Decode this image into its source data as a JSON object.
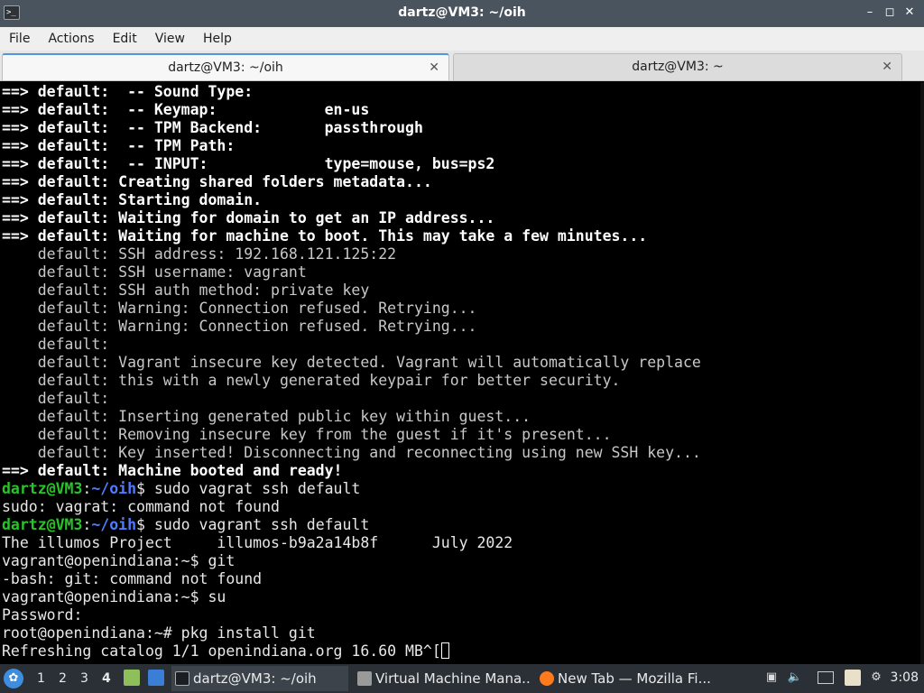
{
  "window": {
    "title": "dartz@VM3: ~/oih",
    "app_icon": "terminal-icon",
    "controls": [
      "minimize-icon",
      "maximize-icon",
      "close-icon"
    ]
  },
  "menu": [
    "File",
    "Actions",
    "Edit",
    "View",
    "Help"
  ],
  "tabs": [
    {
      "label": "dartz@VM3: ~/oih",
      "active": true
    },
    {
      "label": "dartz@VM3: ~",
      "active": false
    }
  ],
  "terminal": {
    "lines": [
      [
        {
          "t": "==> default:  -- Sound Type:",
          "s": "bold"
        }
      ],
      [
        {
          "t": "==> default:  -- Keymap:            en-us",
          "s": "bold"
        }
      ],
      [
        {
          "t": "==> default:  -- TPM Backend:       passthrough",
          "s": "bold"
        }
      ],
      [
        {
          "t": "==> default:  -- TPM Path:",
          "s": "bold"
        }
      ],
      [
        {
          "t": "==> default:  -- INPUT:             type=mouse, bus=ps2",
          "s": "bold"
        }
      ],
      [
        {
          "t": "==> default: Creating shared folders metadata...",
          "s": "bold"
        }
      ],
      [
        {
          "t": "==> default: Starting domain.",
          "s": "bold"
        }
      ],
      [
        {
          "t": "==> default: Waiting for domain to get an IP address...",
          "s": "bold"
        }
      ],
      [
        {
          "t": "==> default: Waiting for machine to boot. This may take a few minutes...",
          "s": "bold"
        }
      ],
      [
        {
          "t": "    default: SSH address: 192.168.121.125:22",
          "s": "dim"
        }
      ],
      [
        {
          "t": "    default: SSH username: vagrant",
          "s": "dim"
        }
      ],
      [
        {
          "t": "    default: SSH auth method: private key",
          "s": "dim"
        }
      ],
      [
        {
          "t": "    default: Warning: Connection refused. Retrying...",
          "s": "dim"
        }
      ],
      [
        {
          "t": "    default: Warning: Connection refused. Retrying...",
          "s": "dim"
        }
      ],
      [
        {
          "t": "    default:",
          "s": "dim"
        }
      ],
      [
        {
          "t": "    default: Vagrant insecure key detected. Vagrant will automatically replace",
          "s": "dim"
        }
      ],
      [
        {
          "t": "    default: this with a newly generated keypair for better security.",
          "s": "dim"
        }
      ],
      [
        {
          "t": "    default:",
          "s": "dim"
        }
      ],
      [
        {
          "t": "    default: Inserting generated public key within guest...",
          "s": "dim"
        }
      ],
      [
        {
          "t": "    default: Removing insecure key from the guest if it's present...",
          "s": "dim"
        }
      ],
      [
        {
          "t": "    default: Key inserted! Disconnecting and reconnecting using new SSH key...",
          "s": "dim"
        }
      ],
      [
        {
          "t": "==> default: Machine booted and ready!",
          "s": "bold"
        }
      ],
      [
        {
          "t": "dartz@VM3",
          "s": "prompt-user"
        },
        {
          "t": ":",
          "s": "normal"
        },
        {
          "t": "~/oih",
          "s": "prompt-path"
        },
        {
          "t": "$ sudo vagrat ssh default",
          "s": "normal"
        }
      ],
      [
        {
          "t": "sudo: vagrat: command not found",
          "s": "normal"
        }
      ],
      [
        {
          "t": "dartz@VM3",
          "s": "prompt-user"
        },
        {
          "t": ":",
          "s": "normal"
        },
        {
          "t": "~/oih",
          "s": "prompt-path"
        },
        {
          "t": "$ sudo vagrant ssh default",
          "s": "normal"
        }
      ],
      [
        {
          "t": "The illumos Project     illumos-b9a2a14b8f      July 2022",
          "s": "normal"
        }
      ],
      [
        {
          "t": "vagrant@openindiana:~$ git",
          "s": "normal"
        }
      ],
      [
        {
          "t": "-bash: git: command not found",
          "s": "normal"
        }
      ],
      [
        {
          "t": "vagrant@openindiana:~$ su",
          "s": "normal"
        }
      ],
      [
        {
          "t": "Password:",
          "s": "normal"
        }
      ],
      [
        {
          "t": "root@openindiana:~# pkg install git",
          "s": "normal"
        }
      ],
      [
        {
          "t": "Refreshing catalog 1/1 openindiana.org 16.60 MB^[",
          "s": "normal"
        }
      ]
    ]
  },
  "taskbar": {
    "start_icon": "lxqt-start-icon",
    "desktops": [
      "1",
      "2",
      "3",
      "4"
    ],
    "active_desktop": "4",
    "quicklaunch": [
      "file-manager-icon",
      "show-desktop-icon"
    ],
    "tasks": [
      {
        "label": "dartz@VM3: ~/oih",
        "icon": "terminal-icon",
        "active": true
      },
      {
        "label": "Virtual Machine Mana...",
        "icon": "virt-manager-icon",
        "active": false
      },
      {
        "label": "New Tab — Mozilla Fi...",
        "icon": "firefox-icon",
        "active": false
      }
    ],
    "tray": [
      "screen-icon",
      "volume-icon",
      "network-icon",
      "clipboard-icon",
      "updates-icon"
    ],
    "clock": "3:08"
  },
  "colors": {
    "titlebar": "#4a545e",
    "prompt_user": "#27c527",
    "prompt_path": "#4f7cff",
    "tab_accent": "#5294e2",
    "taskbar": "#2b3036"
  }
}
